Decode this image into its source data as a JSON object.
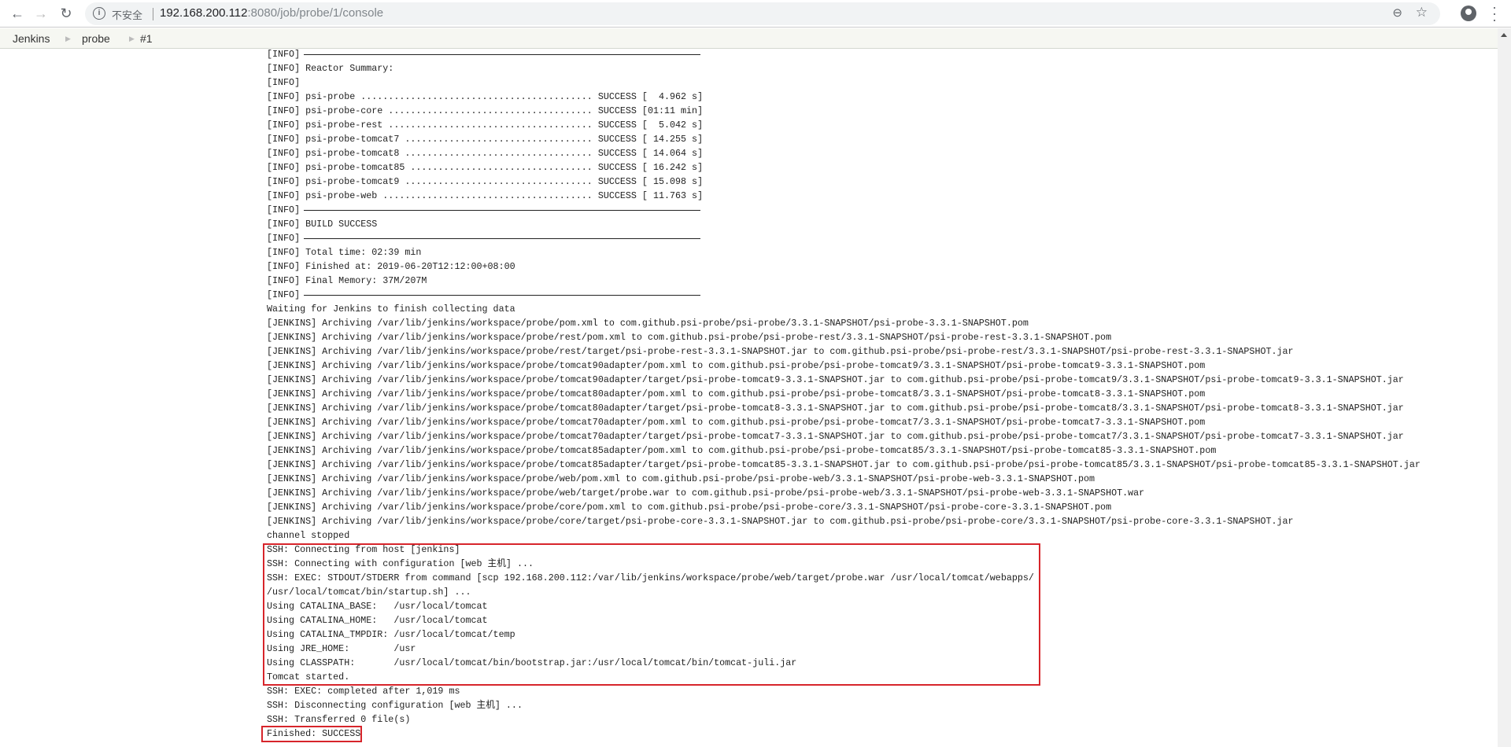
{
  "browser": {
    "insecure_label": "不安全",
    "url_host": "192.168.200.112",
    "url_rest": ":8080/job/probe/1/console"
  },
  "breadcrumb": [
    "Jenkins",
    "probe",
    "#1"
  ],
  "colors": {
    "highlight": "#d7252b"
  },
  "log": [
    {
      "text": "[INFO] ",
      "rule": true
    },
    {
      "text": "[INFO] Reactor Summary:"
    },
    {
      "text": "[INFO]"
    },
    {
      "text": "[INFO] psi-probe .......................................... SUCCESS [  4.962 s]"
    },
    {
      "text": "[INFO] psi-probe-core ..................................... SUCCESS [01:11 min]"
    },
    {
      "text": "[INFO] psi-probe-rest ..................................... SUCCESS [  5.042 s]"
    },
    {
      "text": "[INFO] psi-probe-tomcat7 .................................. SUCCESS [ 14.255 s]"
    },
    {
      "text": "[INFO] psi-probe-tomcat8 .................................. SUCCESS [ 14.064 s]"
    },
    {
      "text": "[INFO] psi-probe-tomcat85 ................................. SUCCESS [ 16.242 s]"
    },
    {
      "text": "[INFO] psi-probe-tomcat9 .................................. SUCCESS [ 15.098 s]"
    },
    {
      "text": "[INFO] psi-probe-web ...................................... SUCCESS [ 11.763 s]"
    },
    {
      "text": "[INFO] ",
      "rule": true
    },
    {
      "text": "[INFO] BUILD SUCCESS"
    },
    {
      "text": "[INFO] ",
      "rule": true
    },
    {
      "text": "[INFO] Total time: 02:39 min"
    },
    {
      "text": "[INFO] Finished at: 2019-06-20T12:12:00+08:00"
    },
    {
      "text": "[INFO] Final Memory: 37M/207M"
    },
    {
      "text": "[INFO] ",
      "rule": true
    },
    {
      "text": "Waiting for Jenkins to finish collecting data"
    },
    {
      "text": "[JENKINS] Archiving /var/lib/jenkins/workspace/probe/pom.xml to com.github.psi-probe/psi-probe/3.3.1-SNAPSHOT/psi-probe-3.3.1-SNAPSHOT.pom"
    },
    {
      "text": "[JENKINS] Archiving /var/lib/jenkins/workspace/probe/rest/pom.xml to com.github.psi-probe/psi-probe-rest/3.3.1-SNAPSHOT/psi-probe-rest-3.3.1-SNAPSHOT.pom"
    },
    {
      "text": "[JENKINS] Archiving /var/lib/jenkins/workspace/probe/rest/target/psi-probe-rest-3.3.1-SNAPSHOT.jar to com.github.psi-probe/psi-probe-rest/3.3.1-SNAPSHOT/psi-probe-rest-3.3.1-SNAPSHOT.jar"
    },
    {
      "text": "[JENKINS] Archiving /var/lib/jenkins/workspace/probe/tomcat90adapter/pom.xml to com.github.psi-probe/psi-probe-tomcat9/3.3.1-SNAPSHOT/psi-probe-tomcat9-3.3.1-SNAPSHOT.pom"
    },
    {
      "text": "[JENKINS] Archiving /var/lib/jenkins/workspace/probe/tomcat90adapter/target/psi-probe-tomcat9-3.3.1-SNAPSHOT.jar to com.github.psi-probe/psi-probe-tomcat9/3.3.1-SNAPSHOT/psi-probe-tomcat9-3.3.1-SNAPSHOT.jar"
    },
    {
      "text": "[JENKINS] Archiving /var/lib/jenkins/workspace/probe/tomcat80adapter/pom.xml to com.github.psi-probe/psi-probe-tomcat8/3.3.1-SNAPSHOT/psi-probe-tomcat8-3.3.1-SNAPSHOT.pom"
    },
    {
      "text": "[JENKINS] Archiving /var/lib/jenkins/workspace/probe/tomcat80adapter/target/psi-probe-tomcat8-3.3.1-SNAPSHOT.jar to com.github.psi-probe/psi-probe-tomcat8/3.3.1-SNAPSHOT/psi-probe-tomcat8-3.3.1-SNAPSHOT.jar"
    },
    {
      "text": "[JENKINS] Archiving /var/lib/jenkins/workspace/probe/tomcat70adapter/pom.xml to com.github.psi-probe/psi-probe-tomcat7/3.3.1-SNAPSHOT/psi-probe-tomcat7-3.3.1-SNAPSHOT.pom"
    },
    {
      "text": "[JENKINS] Archiving /var/lib/jenkins/workspace/probe/tomcat70adapter/target/psi-probe-tomcat7-3.3.1-SNAPSHOT.jar to com.github.psi-probe/psi-probe-tomcat7/3.3.1-SNAPSHOT/psi-probe-tomcat7-3.3.1-SNAPSHOT.jar"
    },
    {
      "text": "[JENKINS] Archiving /var/lib/jenkins/workspace/probe/tomcat85adapter/pom.xml to com.github.psi-probe/psi-probe-tomcat85/3.3.1-SNAPSHOT/psi-probe-tomcat85-3.3.1-SNAPSHOT.pom"
    },
    {
      "text": "[JENKINS] Archiving /var/lib/jenkins/workspace/probe/tomcat85adapter/target/psi-probe-tomcat85-3.3.1-SNAPSHOT.jar to com.github.psi-probe/psi-probe-tomcat85/3.3.1-SNAPSHOT/psi-probe-tomcat85-3.3.1-SNAPSHOT.jar"
    },
    {
      "text": "[JENKINS] Archiving /var/lib/jenkins/workspace/probe/web/pom.xml to com.github.psi-probe/psi-probe-web/3.3.1-SNAPSHOT/psi-probe-web-3.3.1-SNAPSHOT.pom"
    },
    {
      "text": "[JENKINS] Archiving /var/lib/jenkins/workspace/probe/web/target/probe.war to com.github.psi-probe/psi-probe-web/3.3.1-SNAPSHOT/psi-probe-web-3.3.1-SNAPSHOT.war"
    },
    {
      "text": "[JENKINS] Archiving /var/lib/jenkins/workspace/probe/core/pom.xml to com.github.psi-probe/psi-probe-core/3.3.1-SNAPSHOT/psi-probe-core-3.3.1-SNAPSHOT.pom"
    },
    {
      "text": "[JENKINS] Archiving /var/lib/jenkins/workspace/probe/core/target/psi-probe-core-3.3.1-SNAPSHOT.jar to com.github.psi-probe/psi-probe-core/3.3.1-SNAPSHOT/psi-probe-core-3.3.1-SNAPSHOT.jar"
    },
    {
      "text": "channel stopped"
    },
    {
      "text": "SSH: Connecting from host [jenkins]"
    },
    {
      "text": "SSH: Connecting with configuration [web 主机] ..."
    },
    {
      "text": "SSH: EXEC: STDOUT/STDERR from command [scp 192.168.200.112:/var/lib/jenkins/workspace/probe/web/target/probe.war /usr/local/tomcat/webapps/"
    },
    {
      "text": "/usr/local/tomcat/bin/startup.sh] ..."
    },
    {
      "text": "Using CATALINA_BASE:   /usr/local/tomcat"
    },
    {
      "text": "Using CATALINA_HOME:   /usr/local/tomcat"
    },
    {
      "text": "Using CATALINA_TMPDIR: /usr/local/tomcat/temp"
    },
    {
      "text": "Using JRE_HOME:        /usr"
    },
    {
      "text": "Using CLASSPATH:       /usr/local/tomcat/bin/bootstrap.jar:/usr/local/tomcat/bin/tomcat-juli.jar"
    },
    {
      "text": "Tomcat started."
    },
    {
      "text": "SSH: EXEC: completed after 1,019 ms"
    },
    {
      "text": "SSH: Disconnecting configuration [web 主机] ..."
    },
    {
      "text": "SSH: Transferred 0 file(s)"
    },
    {
      "text": "Finished: SUCCESS"
    }
  ]
}
